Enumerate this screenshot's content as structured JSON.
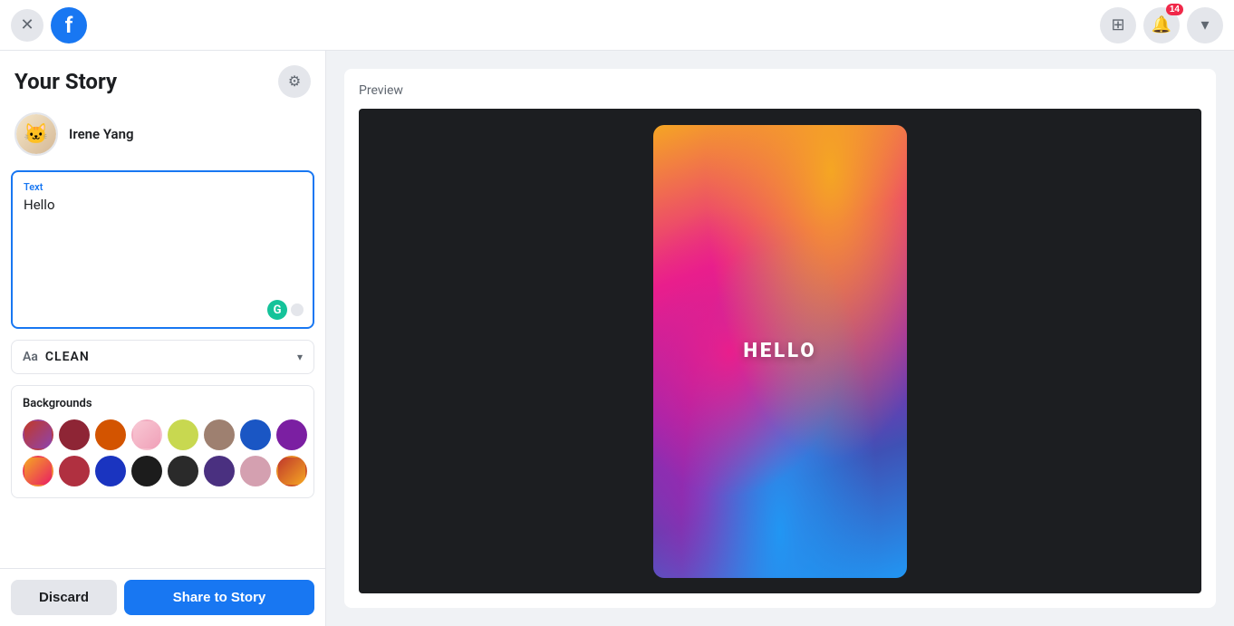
{
  "topbar": {
    "close_label": "✕",
    "facebook_logo": "f",
    "notification_count": "14",
    "grid_icon": "⋮⋮⋮",
    "bell_icon": "🔔",
    "chevron_icon": "▾"
  },
  "left_panel": {
    "title": "Your Story",
    "gear_icon": "⚙",
    "user": {
      "name": "Irene Yang",
      "avatar_emoji": "🐱"
    },
    "text_field": {
      "label": "Text",
      "value": "Hello",
      "placeholder": ""
    },
    "font_dropdown": {
      "aa_label": "Aa",
      "font_name": "CLEAN",
      "chevron": "▾"
    },
    "backgrounds": {
      "title": "Backgrounds",
      "swatches": [
        {
          "id": "bg1",
          "color": "linear-gradient(135deg, #c0392b 0%, #8e44ad 100%)"
        },
        {
          "id": "bg2",
          "color": "#8e2535"
        },
        {
          "id": "bg3",
          "color": "#d35400"
        },
        {
          "id": "bg4",
          "color": "linear-gradient(135deg, #f8c8d4 0%, #f0a0b8 100%)"
        },
        {
          "id": "bg5",
          "color": "#c8d850"
        },
        {
          "id": "bg6",
          "color": "#9e8070"
        },
        {
          "id": "bg7",
          "color": "#1a56c4"
        },
        {
          "id": "bg8",
          "color": "#7b1fa2"
        },
        {
          "id": "bg9",
          "color": "linear-gradient(135deg, #f5a623 0%, #e91e63 100%)"
        },
        {
          "id": "bg10",
          "color": "#b03040"
        },
        {
          "id": "bg11",
          "color": "#1a34c0"
        },
        {
          "id": "bg12",
          "color": "#1c1c1c"
        },
        {
          "id": "bg13",
          "color": "#2a2a2a"
        },
        {
          "id": "bg14",
          "color": "#4a3080"
        },
        {
          "id": "bg15",
          "color": "#d4a0b0"
        },
        {
          "id": "bg16",
          "color": "linear-gradient(135deg, #c0392b 0%, #f5a623 100%)"
        }
      ]
    },
    "discard_label": "Discard",
    "share_label": "Share to Story"
  },
  "right_panel": {
    "preview_label": "Preview",
    "story_text": "HELLO"
  }
}
